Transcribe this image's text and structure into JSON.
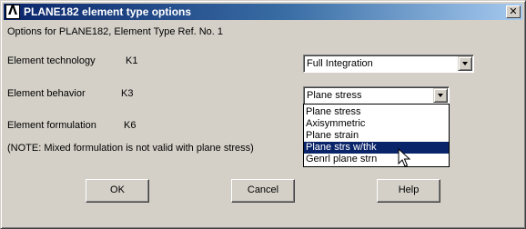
{
  "window": {
    "title": "PLANE182 element type options",
    "close_glyph": "✕",
    "app_icon": "ansys-logo-icon"
  },
  "header": "Options for PLANE182, Element Type Ref. No. 1",
  "fields": {
    "technology": {
      "label": "Element technology",
      "key": "K1",
      "value": "Full Integration"
    },
    "behavior": {
      "label": "Element behavior",
      "key": "K3",
      "value": "Plane stress"
    },
    "formulation": {
      "label": "Element formulation",
      "key": "K6"
    }
  },
  "note": "(NOTE: Mixed formulation is not valid with plane stress)",
  "behavior_options": [
    "Plane stress",
    "Axisymmetric",
    "Plane strain",
    "Plane strs w/thk",
    "Genrl plane strn"
  ],
  "highlighted_option_index": 3,
  "buttons": {
    "ok": "OK",
    "cancel": "Cancel",
    "help": "Help"
  },
  "colors": {
    "highlight": "#0a246a",
    "titlebar": "#0a246a",
    "face": "#d4d0c8"
  },
  "cursor": "arrow-pointer-icon"
}
